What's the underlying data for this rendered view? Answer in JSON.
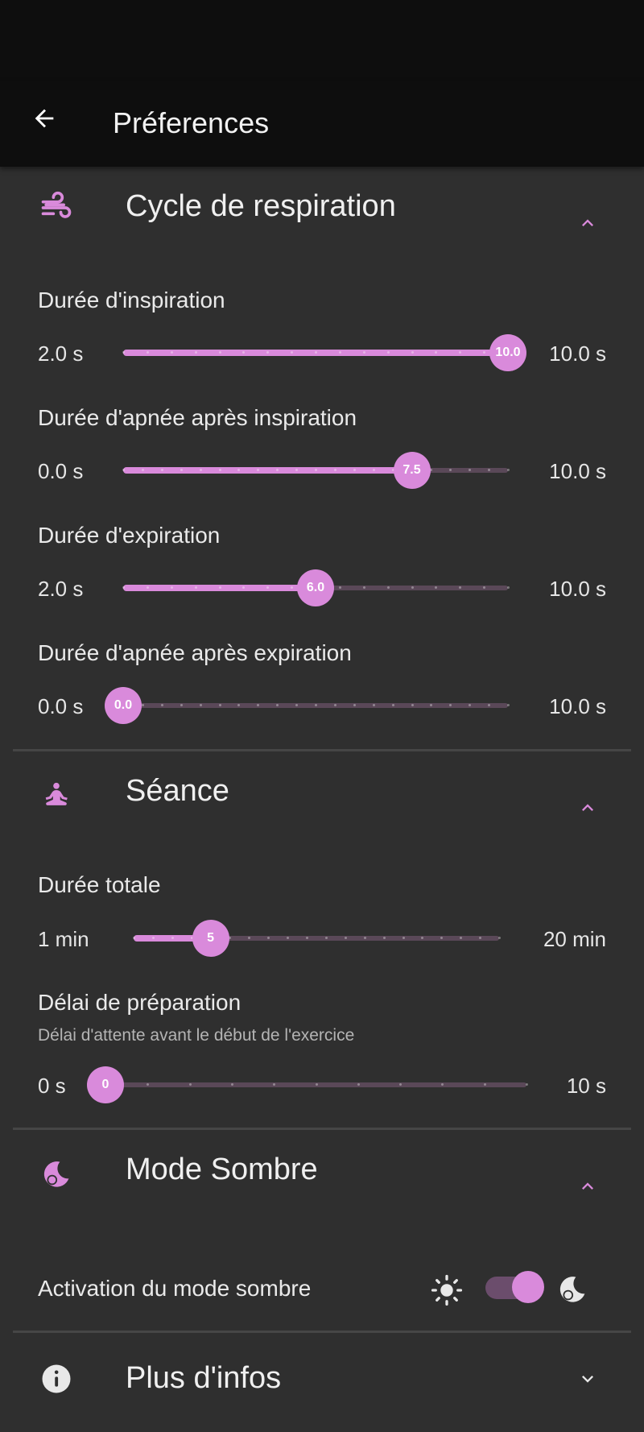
{
  "app_bar": {
    "title": "Préferences"
  },
  "sections": {
    "breathing": {
      "title": "Cycle de respiration",
      "sliders": [
        {
          "label": "Durée d'inspiration",
          "min_label": "2.0 s",
          "max_label": "10.0 s",
          "value_label": "10.0",
          "value": 10.0,
          "min": 2.0,
          "max": 10.0,
          "step": 0.5
        },
        {
          "label": "Durée d'apnée après inspiration",
          "min_label": "0.0 s",
          "max_label": "10.0 s",
          "value_label": "7.5",
          "value": 7.5,
          "min": 0.0,
          "max": 10.0,
          "step": 0.5
        },
        {
          "label": "Durée d'expiration",
          "min_label": "2.0 s",
          "max_label": "10.0 s",
          "value_label": "6.0",
          "value": 6.0,
          "min": 2.0,
          "max": 10.0,
          "step": 0.5
        },
        {
          "label": "Durée d'apnée après expiration",
          "min_label": "0.0 s",
          "max_label": "10.0 s",
          "value_label": "0.0",
          "value": 0.0,
          "min": 0.0,
          "max": 10.0,
          "step": 0.5
        }
      ]
    },
    "session": {
      "title": "Séance",
      "sliders": [
        {
          "label": "Durée totale",
          "min_label": "1 min",
          "max_label": "20 min",
          "value_label": "5",
          "value": 5,
          "min": 1,
          "max": 20,
          "step": 1
        },
        {
          "label": "Délai de préparation",
          "sublabel": "Délai d'attente avant le début de l'exercice",
          "min_label": "0 s",
          "max_label": "10 s",
          "value_label": "0",
          "value": 0,
          "min": 0,
          "max": 10,
          "step": 1
        }
      ]
    },
    "dark_mode": {
      "title": "Mode Sombre",
      "toggle_label": "Activation du mode sombre",
      "toggle_on": true
    },
    "more_info": {
      "title": "Plus d'infos"
    }
  },
  "colors": {
    "accent": "#d98adb",
    "background": "#2f2f2f",
    "app_bar": "#0e0e0e",
    "track_inactive": "#5a4858"
  },
  "icons": {
    "back": "arrow-left-icon",
    "breathing": "wind-icon",
    "session": "meditation-icon",
    "dark_mode": "moon-icon",
    "more_info": "info-icon",
    "expand_less": "chevron-up-icon",
    "expand_more": "chevron-down-icon",
    "light": "sun-icon",
    "dark": "moon-icon"
  }
}
